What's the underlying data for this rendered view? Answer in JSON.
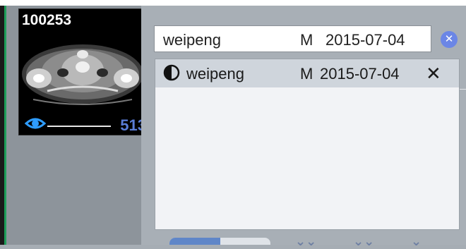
{
  "thumbnail": {
    "series_id": "100253",
    "slice_number": "513"
  },
  "search": {
    "name": "weipeng",
    "sex": "M",
    "date": "2015-07-04",
    "clear_icon": "clear-icon"
  },
  "dropdown": {
    "items": [
      {
        "icon": "eye-icon",
        "name": "weipeng",
        "sex": "M",
        "date": "2015-07-04",
        "remove": "✕"
      }
    ]
  },
  "colors": {
    "accent_blue": "#5a7dd6",
    "selected_row": "#cfd5dc",
    "panel_bg": "#a8afb6"
  }
}
